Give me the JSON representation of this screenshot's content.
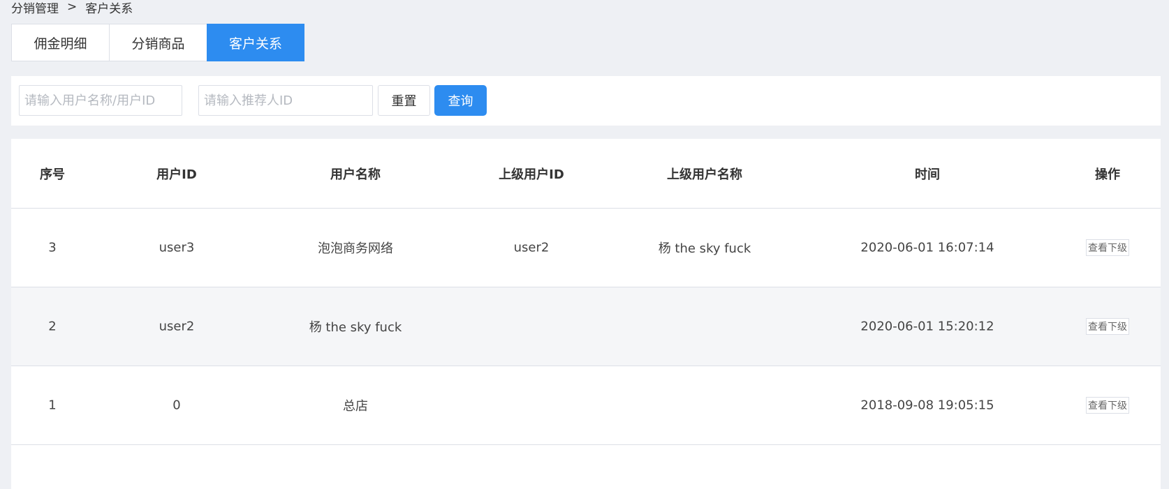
{
  "breadcrumb": {
    "parent": "分销管理",
    "separator": ">",
    "current": "客户关系"
  },
  "tabs": [
    {
      "label": "佣金明细",
      "active": false
    },
    {
      "label": "分销商品",
      "active": false
    },
    {
      "label": "客户关系",
      "active": true
    }
  ],
  "search": {
    "user_placeholder": "请输入用户名称/用户ID",
    "referrer_placeholder": "请输入推荐人ID",
    "reset_label": "重置",
    "query_label": "查询"
  },
  "table": {
    "columns": [
      "序号",
      "用户ID",
      "用户名称",
      "上级用户ID",
      "上级用户名称",
      "时间",
      "操作"
    ],
    "rows": [
      {
        "index": "3",
        "user_id": "user3",
        "user_name": "泡泡商务网络",
        "parent_id": "user2",
        "parent_name": "杨 the sky fuck",
        "time": "2020-06-01 16:07:14",
        "action": "查看下级"
      },
      {
        "index": "2",
        "user_id": "user2",
        "user_name": "杨 the sky fuck",
        "parent_id": "",
        "parent_name": "",
        "time": "2020-06-01 15:20:12",
        "action": "查看下级"
      },
      {
        "index": "1",
        "user_id": "0",
        "user_name": "总店",
        "parent_id": "",
        "parent_name": "",
        "time": "2018-09-08 19:05:15",
        "action": "查看下级"
      }
    ]
  },
  "colors": {
    "accent": "#2d8cf0",
    "background": "#eef0f4",
    "alt_row": "#f5f6f8"
  }
}
